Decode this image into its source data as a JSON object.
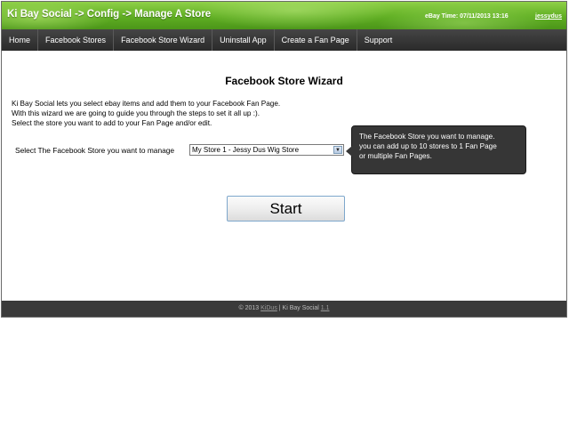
{
  "header": {
    "title": "Ki Bay Social -> Config -> Manage A Store",
    "ebay_time": "eBay Time: 07/11/2013 13:16",
    "username": "jessydus"
  },
  "nav": {
    "items": [
      {
        "label": "Home"
      },
      {
        "label": "Facebook Stores"
      },
      {
        "label": "Facebook Store Wizard"
      },
      {
        "label": "Uninstall App"
      },
      {
        "label": "Create a Fan Page"
      },
      {
        "label": "Support"
      }
    ]
  },
  "main": {
    "title": "Facebook Store Wizard",
    "intro_lines": [
      "Ki Bay Social lets you select ebay items and add them to your Facebook Fan Page.",
      "With this wizard we are going to guide you through the steps to set it all up :).",
      "Select the store you want to add to your Fan Page and/or edit."
    ],
    "store_label": "Select The Facebook Store you want to manage",
    "store_selected": "My Store 1 - Jessy Dus Wig Store",
    "tooltip_lines": [
      "The Facebook Store you want to manage.",
      "you can add up to 10 stores to 1 Fan Page",
      "or multiple Fan Pages."
    ],
    "start_label": "Start"
  },
  "footer": {
    "copyright": "© 2013",
    "company_link": "KiDus",
    "separator": "| Ki Bay Social",
    "version_link": "1.1"
  },
  "icons": {
    "select_arrow": "chevron-down-icon"
  }
}
